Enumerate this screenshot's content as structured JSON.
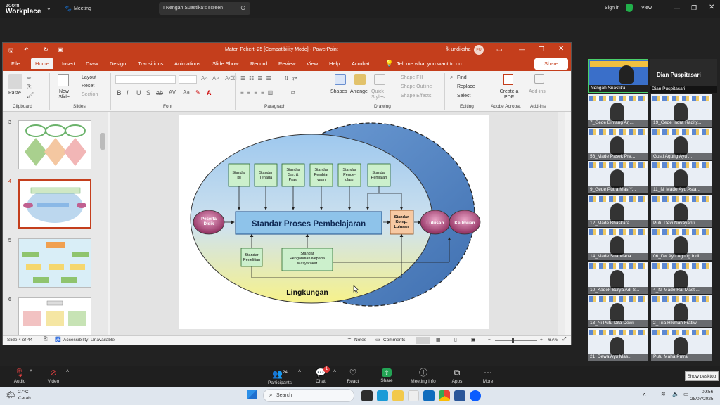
{
  "zoom_top": {
    "logo_line1": "zoom",
    "logo_line2": "Workplace",
    "meeting_tab": "Meeting",
    "share_tab": "I Nengah Suastika's screen",
    "sign_in": "Sign in",
    "view": "View"
  },
  "ppt": {
    "window_title": "Materi Pekerti-25 [Compatibility Mode] - PowerPoint",
    "account": "fk undiksha",
    "account_initials": "FU",
    "tabs": [
      "File",
      "Home",
      "Insert",
      "Draw",
      "Design",
      "Transitions",
      "Animations",
      "Slide Show",
      "Record",
      "Review",
      "View",
      "Help",
      "Acrobat"
    ],
    "tell_me": "Tell me what you want to do",
    "share_button": "Share",
    "ribbon": {
      "paste": "Paste",
      "new_slide": "New Slide",
      "layout": "Layout",
      "reset": "Reset",
      "section": "Section",
      "shapes": "Shapes",
      "arrange": "Arrange",
      "quick_styles": "Quick Styles",
      "shape_fill": "Shape Fill",
      "shape_outline": "Shape Outline",
      "shape_effects": "Shape Effects",
      "find": "Find",
      "replace": "Replace",
      "select": "Select",
      "create_pdf": "Create a PDF",
      "add_ins": "Add-ins",
      "groups": [
        "Clipboard",
        "Slides",
        "Font",
        "Paragraph",
        "Drawing",
        "Editing",
        "Adobe Acrobat",
        "Add-ins"
      ]
    },
    "thumb_numbers": [
      "3",
      "4",
      "5",
      "6"
    ],
    "status": {
      "slide_of": "Slide 4 of 44",
      "accessibility": "Accessibility: Unavailable",
      "notes": "Notes",
      "comments": "Comments",
      "zoom": "67%"
    }
  },
  "slide": {
    "boxes": [
      "Standar Isi",
      "Standar Tenaga",
      "Standar Sar. & Pras.",
      "Standar Pembia-yaan",
      "Standar Penge-lolaan",
      "Standar Penilaian"
    ],
    "main_process": "Standar Proses Pembelajaran",
    "input": "Peserta Didik",
    "komp": "Standar Komp. Lulusan",
    "lulusan": "Lulusan",
    "kelimuan": "Keilmuan",
    "penelitian": "Standar Penelitian",
    "pengabdian": "Standar Pengabdian Kepada Masyarakat",
    "lingkungan": "Lingkungan"
  },
  "gallery": {
    "presenter": "Nengah Suastika",
    "host": "Dian Puspitasari",
    "host_tile": "Dian Puspitasari",
    "participants": [
      "7_Gede Bintang Arj...",
      "19_Gede Indra Radity...",
      "56_Made Pasek Pra...",
      "Gusti Agung Ayu ...",
      "9_Gede Putra Mas Y...",
      "11_Ni Made Ayu Asta...",
      "12_Made Bhaskara",
      "Putu Devi Novayanti",
      "14_Made Suandana",
      "06_Dw Ayu Agung Indi...",
      "10_Kadek Surya Adi S...",
      "4_Ni Made Rai Masti...",
      "13_Ni Putu Dita Dewi",
      "2_Tria Hikmah Fratiwi",
      "21_Dewa Ayu Mas...",
      "Putu Maha Putra"
    ]
  },
  "zoom_bottom": {
    "audio": "Audio",
    "video": "Video",
    "participants": "Participants",
    "participants_count": "24",
    "chat": "Chat",
    "chat_badge": "1",
    "react": "React",
    "share": "Share",
    "meeting_info": "Meeting info",
    "apps": "Apps",
    "more": "More",
    "show_desktop": "Show desktop"
  },
  "taskbar": {
    "weather_temp": "27°C",
    "weather_text": "Cerah",
    "search_placeholder": "Search",
    "time": "09:56",
    "date": "28/07/2025"
  }
}
